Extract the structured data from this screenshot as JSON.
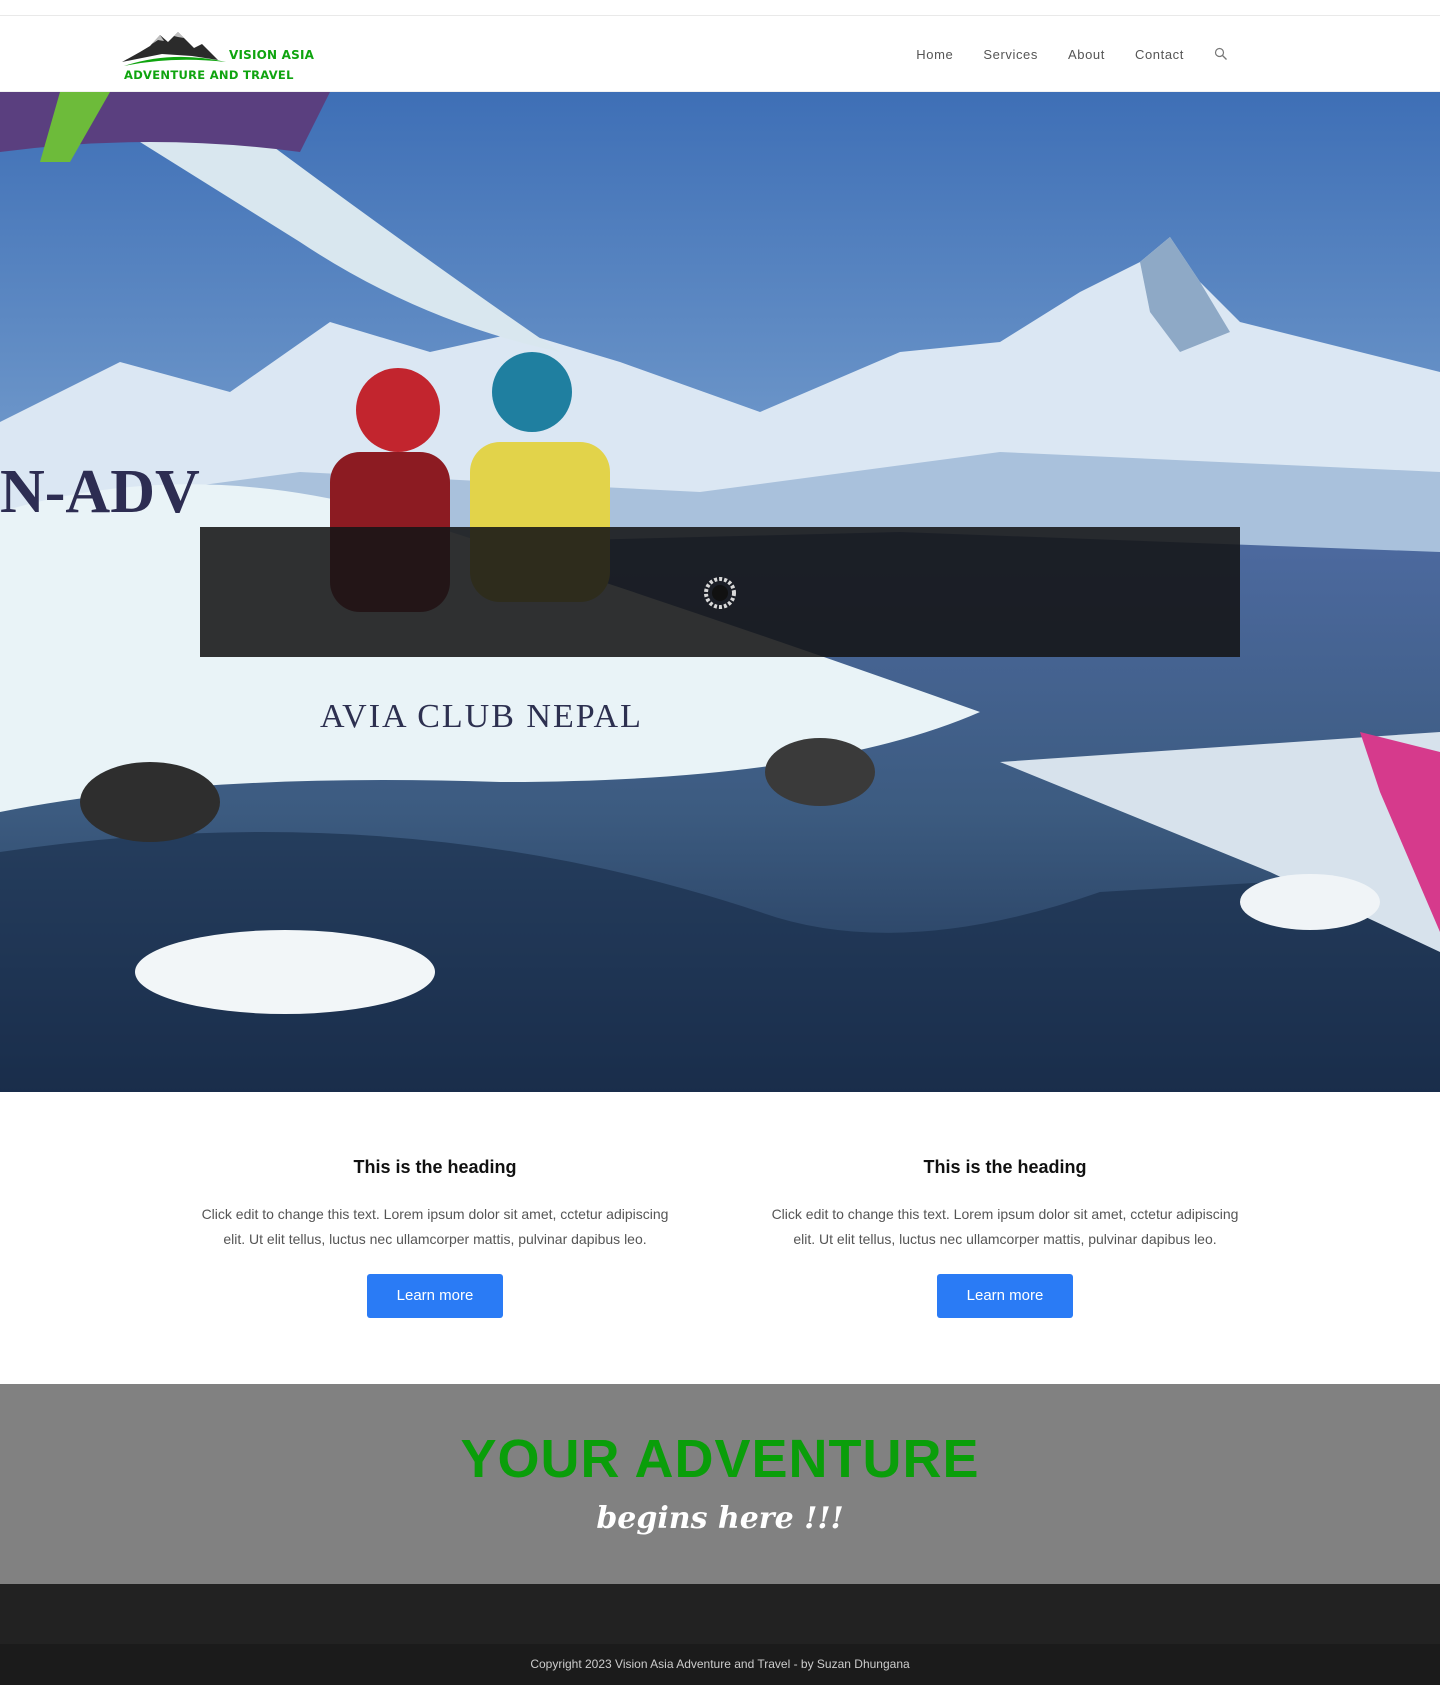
{
  "brand": {
    "line1": "VISION ASIA",
    "line2": "ADVENTURE AND TRAVEL",
    "color": "#0fa40f"
  },
  "nav": {
    "items": [
      {
        "label": "Home"
      },
      {
        "label": "Services"
      },
      {
        "label": "About"
      },
      {
        "label": "Contact"
      }
    ],
    "search_icon": "search-icon"
  },
  "hero": {
    "aircraft_text": "AVIA CLUB NEPAL",
    "registration_text": "N-ADV",
    "loader_icon": "loading-spinner-icon"
  },
  "features": [
    {
      "heading": "This is the heading",
      "text": "Click edit to change this text. Lorem ipsum dolor sit amet, cctetur adipiscing elit. Ut elit tellus, luctus nec ullamcorper mattis, pulvinar dapibus leo.",
      "button": "Learn more"
    },
    {
      "heading": "This is the heading",
      "text": "Click edit to change this text. Lorem ipsum dolor sit amet, cctetur adipiscing elit. Ut elit tellus, luctus nec ullamcorper mattis, pulvinar dapibus leo.",
      "button": "Learn more"
    }
  ],
  "banner": {
    "title": "YOUR ADVENTURE",
    "subtitle": "begins here !!!",
    "title_color": "#0a9e0a"
  },
  "footer": {
    "copyright": "Copyright 2023 Vision Asia Adventure and Travel - by Suzan Dhungana"
  },
  "colors": {
    "button": "#2a7bf5",
    "banner_bg": "#818181",
    "footer_bg": "#222222"
  }
}
